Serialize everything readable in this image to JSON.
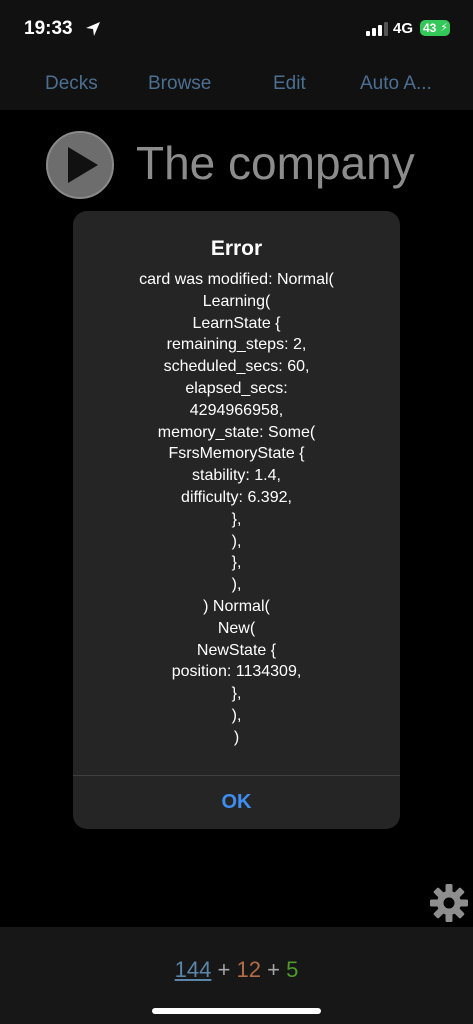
{
  "status_bar": {
    "time": "19:33",
    "network": "4G",
    "battery": "43",
    "location_icon": "location-arrow-icon",
    "signal_icon": "cellular-signal-icon",
    "battery_color": "#34c759"
  },
  "nav": {
    "decks": "Decks",
    "browse": "Browse",
    "edit": "Edit",
    "auto": "Auto A...",
    "color": "#4c6f91"
  },
  "deck": {
    "title": "The company",
    "play_icon": "play-icon"
  },
  "alert": {
    "title": "Error",
    "lines": [
      "card was modified: Normal(",
      "Learning(",
      "LearnState {",
      "remaining_steps: 2,",
      "scheduled_secs: 60,",
      "elapsed_secs:",
      "4294966958,",
      "memory_state: Some(",
      "FsrsMemoryState {",
      "stability: 1.4,",
      "difficulty: 6.392,",
      "},",
      "),",
      "},",
      "),",
      ") Normal(",
      "New(",
      "NewState {",
      "position: 1134309,",
      "},",
      "),",
      ")"
    ],
    "ok_label": "OK",
    "ok_color": "#3d8ef0"
  },
  "settings": {
    "gear_icon": "gear-icon"
  },
  "counts": {
    "new": "144",
    "learn": "12",
    "review": "5",
    "plus": "+",
    "new_color": "#5b86aa",
    "learn_color": "#b36c45",
    "review_color": "#4e9a2d"
  }
}
